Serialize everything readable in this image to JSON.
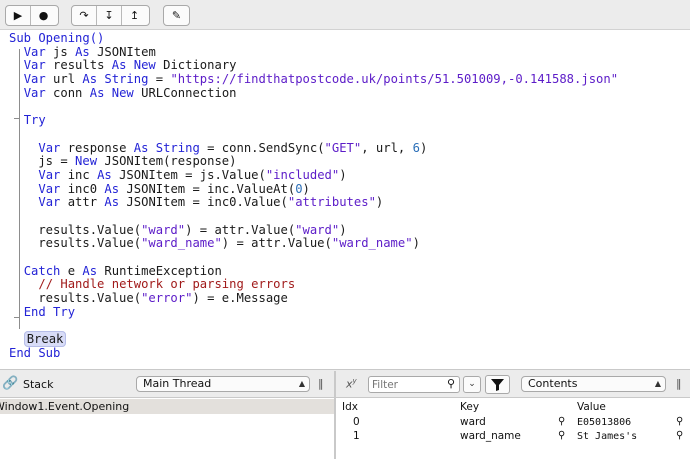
{
  "toolbar": {
    "run_icon": "▶",
    "stop_icon": "●",
    "step_over_icon": "↷",
    "step_into_icon": "↧",
    "step_out_icon": "↥",
    "edit_icon": "✎"
  },
  "code": [
    [
      {
        "t": "Sub Opening()",
        "c": "k"
      }
    ],
    [
      {
        "t": "  "
      },
      {
        "t": "Var",
        "c": "k"
      },
      {
        "t": " js "
      },
      {
        "t": "As",
        "c": "k"
      },
      {
        "t": " JSONItem"
      }
    ],
    [
      {
        "t": "  "
      },
      {
        "t": "Var",
        "c": "k"
      },
      {
        "t": " results "
      },
      {
        "t": "As New",
        "c": "k"
      },
      {
        "t": " Dictionary"
      }
    ],
    [
      {
        "t": "  "
      },
      {
        "t": "Var",
        "c": "k"
      },
      {
        "t": " url "
      },
      {
        "t": "As String",
        "c": "k"
      },
      {
        "t": " = "
      },
      {
        "t": "\"https://findthatpostcode.uk/points/51.501009,-0.141588.json\"",
        "c": "s"
      }
    ],
    [
      {
        "t": "  "
      },
      {
        "t": "Var",
        "c": "k"
      },
      {
        "t": " conn "
      },
      {
        "t": "As New",
        "c": "k"
      },
      {
        "t": " URLConnection"
      }
    ],
    [
      {
        "t": ""
      }
    ],
    [
      {
        "t": "  "
      },
      {
        "t": "Try",
        "c": "k"
      }
    ],
    [
      {
        "t": ""
      }
    ],
    [
      {
        "t": "    "
      },
      {
        "t": "Var",
        "c": "k"
      },
      {
        "t": " response "
      },
      {
        "t": "As String",
        "c": "k"
      },
      {
        "t": " = conn.SendSync("
      },
      {
        "t": "\"GET\"",
        "c": "s"
      },
      {
        "t": ", url, "
      },
      {
        "t": "6",
        "c": "n"
      },
      {
        "t": ")"
      }
    ],
    [
      {
        "t": "    js = "
      },
      {
        "t": "New",
        "c": "k"
      },
      {
        "t": " JSONItem(response)"
      }
    ],
    [
      {
        "t": "    "
      },
      {
        "t": "Var",
        "c": "k"
      },
      {
        "t": " inc "
      },
      {
        "t": "As",
        "c": "k"
      },
      {
        "t": " JSONItem = js.Value("
      },
      {
        "t": "\"included\"",
        "c": "s"
      },
      {
        "t": ")"
      }
    ],
    [
      {
        "t": "    "
      },
      {
        "t": "Var",
        "c": "k"
      },
      {
        "t": " inc0 "
      },
      {
        "t": "As",
        "c": "k"
      },
      {
        "t": " JSONItem = inc.ValueAt("
      },
      {
        "t": "0",
        "c": "n"
      },
      {
        "t": ")"
      }
    ],
    [
      {
        "t": "    "
      },
      {
        "t": "Var",
        "c": "k"
      },
      {
        "t": " attr "
      },
      {
        "t": "As",
        "c": "k"
      },
      {
        "t": " JSONItem = inc0.Value("
      },
      {
        "t": "\"attributes\"",
        "c": "s"
      },
      {
        "t": ")"
      }
    ],
    [
      {
        "t": ""
      }
    ],
    [
      {
        "t": "    results.Value("
      },
      {
        "t": "\"ward\"",
        "c": "s"
      },
      {
        "t": ") = attr.Value("
      },
      {
        "t": "\"ward\"",
        "c": "s"
      },
      {
        "t": ")"
      }
    ],
    [
      {
        "t": "    results.Value("
      },
      {
        "t": "\"ward_name\"",
        "c": "s"
      },
      {
        "t": ") = attr.Value("
      },
      {
        "t": "\"ward_name\"",
        "c": "s"
      },
      {
        "t": ")"
      }
    ],
    [
      {
        "t": ""
      }
    ],
    [
      {
        "t": "  "
      },
      {
        "t": "Catch",
        "c": "k"
      },
      {
        "t": " e "
      },
      {
        "t": "As",
        "c": "k"
      },
      {
        "t": " RuntimeException"
      }
    ],
    [
      {
        "t": "    "
      },
      {
        "t": "// Handle network or parsing errors",
        "c": "c"
      }
    ],
    [
      {
        "t": "    results.Value("
      },
      {
        "t": "\"error\"",
        "c": "s"
      },
      {
        "t": ") = e.Message"
      }
    ],
    [
      {
        "t": "  "
      },
      {
        "t": "End Try",
        "c": "k"
      }
    ],
    [
      {
        "t": ""
      }
    ],
    [
      {
        "t": "  "
      },
      {
        "t": "Break",
        "c": "brk"
      }
    ],
    [
      {
        "t": "End Sub",
        "c": "k"
      }
    ]
  ],
  "stack_pane": {
    "icon": "chain-link-icon",
    "title": "Stack",
    "thread_selected": "Main Thread",
    "frames": [
      "Window1.Event.Opening"
    ]
  },
  "variables_pane": {
    "xy_label": "x",
    "filter_placeholder": "Filter",
    "scope_selected": "Contents",
    "columns": {
      "idx": "Idx",
      "key": "Key",
      "value": "Value"
    },
    "rows": [
      {
        "idx": "0",
        "key": "ward",
        "value": "E05013806"
      },
      {
        "idx": "1",
        "key": "ward_name",
        "value": "St James's"
      }
    ]
  }
}
